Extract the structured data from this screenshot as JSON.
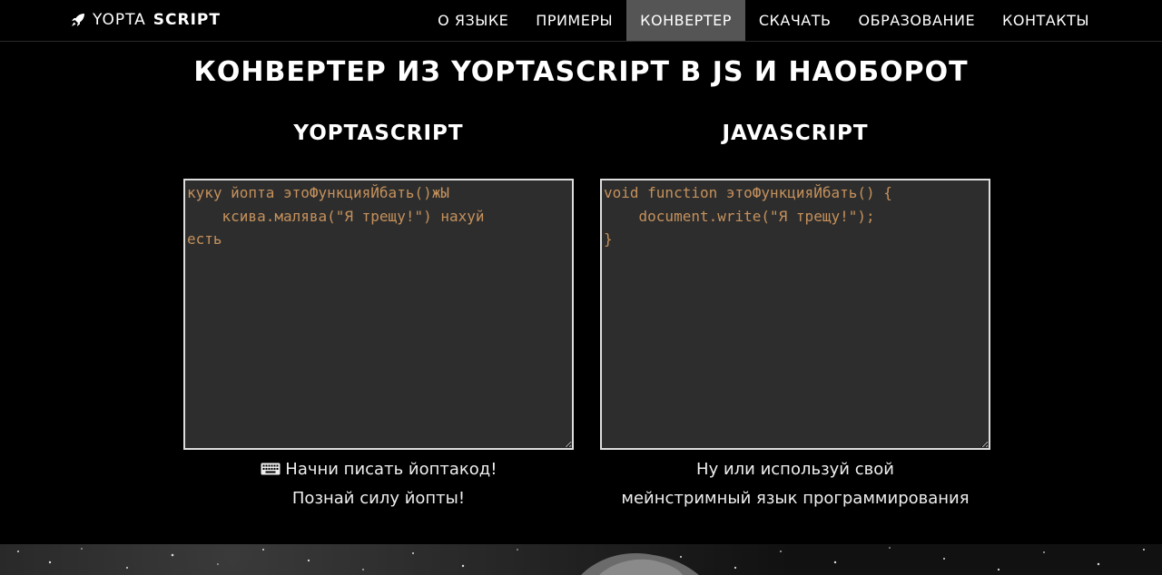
{
  "brand": {
    "light": "YOPTA",
    "bold": "SCRIPT"
  },
  "nav": {
    "items": [
      {
        "label": "О ЯЗЫКЕ",
        "active": false
      },
      {
        "label": "ПРИМЕРЫ",
        "active": false
      },
      {
        "label": "КОНВЕРТЕР",
        "active": true
      },
      {
        "label": "СКАЧАТЬ",
        "active": false
      },
      {
        "label": "ОБРАЗОВАНИЕ",
        "active": false
      },
      {
        "label": "КОНТАКТЫ",
        "active": false
      }
    ]
  },
  "main": {
    "title": "КОНВЕРТЕР ИЗ YOPTASCRIPT В JS И НАОБОРОТ",
    "left": {
      "title": "YOPTASCRIPT",
      "code": "куку йопта этоФункцияЙбать()жЫ\n    ксива.малява(\"Я трещу!\") нахуй\nесть",
      "caption_line1": "Начни писать йоптакод!",
      "caption_line2": "Познай силу йопты!"
    },
    "right": {
      "title": "JAVASCRIPT",
      "code": "void function этоФункцияЙбать() {\n    document.write(\"Я трещу!\");\n}",
      "caption_line1": "Ну или используй свой",
      "caption_line2": "мейнстримный язык программирования"
    }
  },
  "colors": {
    "code_text": "#c5915c",
    "editor_bg": "#2d2d2d",
    "active_nav_bg": "#555555"
  }
}
